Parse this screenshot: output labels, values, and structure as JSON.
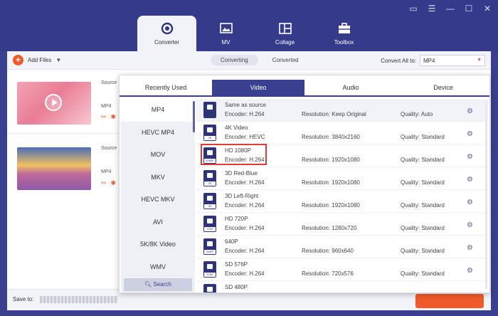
{
  "window_controls": [
    "▭",
    "☰",
    "—",
    "☐",
    "✕"
  ],
  "nav": {
    "tabs": [
      {
        "label": "Converter",
        "icon": "converter-icon",
        "active": true
      },
      {
        "label": "MV",
        "icon": "mv-icon",
        "active": false
      },
      {
        "label": "Collage",
        "icon": "collage-icon",
        "active": false
      },
      {
        "label": "Toolbox",
        "icon": "toolbox-icon",
        "active": false
      }
    ]
  },
  "toolbar": {
    "add_files_label": "Add Files",
    "sub_tabs": [
      "Converting",
      "Converted"
    ],
    "convert_all_label": "Convert All to:",
    "convert_all_value": "MP4"
  },
  "files": [
    {
      "source_label": "Source",
      "format": "MP4"
    },
    {
      "source_label": "Source",
      "format": "MP4"
    }
  ],
  "savebar": {
    "save_label": "Save to:"
  },
  "popup": {
    "tabs": [
      "Recently Used",
      "Video",
      "Audio",
      "Device"
    ],
    "active_tab": "Video",
    "formats": [
      "MP4",
      "HEVC MP4",
      "MOV",
      "MKV",
      "HEVC MKV",
      "AVI",
      "5K/8K Video",
      "WMV"
    ],
    "search_label": "Search",
    "presets": [
      {
        "name": "Same as source",
        "encoder": "Encoder: H.264",
        "resolution": "Resolution: Keep Original",
        "quality": "Quality: Auto",
        "tag": ""
      },
      {
        "name": "4K Video",
        "encoder": "Encoder: HEVC",
        "resolution": "Resolution: 3840x2160",
        "quality": "Quality: Standard",
        "tag": "4K"
      },
      {
        "name": "HD 1080P",
        "encoder": "Encoder: H.264",
        "resolution": "Resolution: 1920x1080",
        "quality": "Quality: Standard",
        "tag": "1080P"
      },
      {
        "name": "3D Red-Blue",
        "encoder": "Encoder: H.264",
        "resolution": "Resolution: 1920x1080",
        "quality": "Quality: Standard",
        "tag": "3D"
      },
      {
        "name": "3D Left-Right",
        "encoder": "Encoder: H.264",
        "resolution": "Resolution: 1920x1080",
        "quality": "Quality: Standard",
        "tag": "3D"
      },
      {
        "name": "HD 720P",
        "encoder": "Encoder: H.264",
        "resolution": "Resolution: 1280x720",
        "quality": "Quality: Standard",
        "tag": "720P"
      },
      {
        "name": "640P",
        "encoder": "Encoder: H.264",
        "resolution": "Resolution: 960x640",
        "quality": "Quality: Standard",
        "tag": "640P"
      },
      {
        "name": "SD 576P",
        "encoder": "Encoder: H.264",
        "resolution": "Resolution: 720x576",
        "quality": "Quality: Standard",
        "tag": "576P"
      },
      {
        "name": "SD 480P",
        "encoder": "",
        "resolution": "",
        "quality": "",
        "tag": ""
      }
    ]
  }
}
